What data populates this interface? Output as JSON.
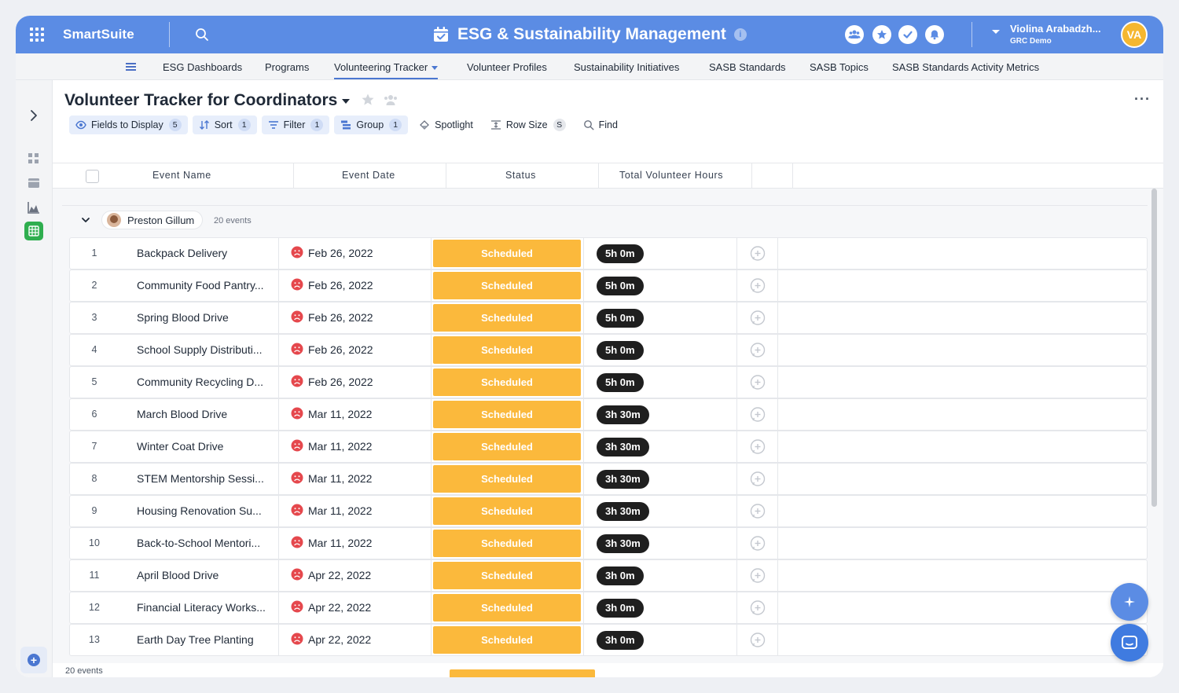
{
  "app": {
    "brand": "SmartSuite",
    "title": "ESG & Sustainability Management",
    "info_glyph": "i",
    "user_name": "Violina Arabadzh...",
    "user_org": "GRC Demo",
    "avatar_initials": "VA"
  },
  "nav": {
    "tabs": [
      {
        "label": "ESG Dashboards"
      },
      {
        "label": "Programs"
      },
      {
        "label": "Volunteering Tracker"
      },
      {
        "label": "Volunteer Profiles"
      },
      {
        "label": "Sustainability Initiatives"
      },
      {
        "label": "SASB Standards"
      },
      {
        "label": "SASB Topics"
      },
      {
        "label": "SASB Standards Activity Metrics"
      }
    ],
    "active_tab": "Volunteering Tracker"
  },
  "view": {
    "title": "Volunteer Tracker for Coordinators",
    "more": "···"
  },
  "toolbar": {
    "fields": {
      "label": "Fields to Display",
      "count": "5"
    },
    "sort": {
      "label": "Sort",
      "count": "1"
    },
    "filter": {
      "label": "Filter",
      "count": "1"
    },
    "group": {
      "label": "Group",
      "count": "1"
    },
    "spotlight": {
      "label": "Spotlight"
    },
    "rowsize": {
      "label": "Row Size",
      "count": "S"
    },
    "find": {
      "label": "Find"
    }
  },
  "grid": {
    "columns": [
      "Event Name",
      "Event Date",
      "Status",
      "Total Volunteer Hours"
    ],
    "group": {
      "name": "Preston Gillum",
      "count": "20 events"
    },
    "rows": [
      {
        "num": "1",
        "name": "Backpack Delivery",
        "date": "Feb 26, 2022",
        "status": "Scheduled",
        "hours": "5h 0m"
      },
      {
        "num": "2",
        "name": "Community Food Pantry...",
        "date": "Feb 26, 2022",
        "status": "Scheduled",
        "hours": "5h 0m"
      },
      {
        "num": "3",
        "name": "Spring Blood Drive",
        "date": "Feb 26, 2022",
        "status": "Scheduled",
        "hours": "5h 0m"
      },
      {
        "num": "4",
        "name": "School Supply Distributi...",
        "date": "Feb 26, 2022",
        "status": "Scheduled",
        "hours": "5h 0m"
      },
      {
        "num": "5",
        "name": "Community Recycling D...",
        "date": "Feb 26, 2022",
        "status": "Scheduled",
        "hours": "5h 0m"
      },
      {
        "num": "6",
        "name": "March Blood Drive",
        "date": "Mar 11, 2022",
        "status": "Scheduled",
        "hours": "3h 30m"
      },
      {
        "num": "7",
        "name": "Winter Coat Drive",
        "date": "Mar 11, 2022",
        "status": "Scheduled",
        "hours": "3h 30m"
      },
      {
        "num": "8",
        "name": "STEM Mentorship Sessi...",
        "date": "Mar 11, 2022",
        "status": "Scheduled",
        "hours": "3h 30m"
      },
      {
        "num": "9",
        "name": "Housing Renovation Su...",
        "date": "Mar 11, 2022",
        "status": "Scheduled",
        "hours": "3h 30m"
      },
      {
        "num": "10",
        "name": "Back-to-School Mentori...",
        "date": "Mar 11, 2022",
        "status": "Scheduled",
        "hours": "3h 30m"
      },
      {
        "num": "11",
        "name": "April Blood Drive",
        "date": "Apr 22, 2022",
        "status": "Scheduled",
        "hours": "3h 0m"
      },
      {
        "num": "12",
        "name": "Financial Literacy Works...",
        "date": "Apr 22, 2022",
        "status": "Scheduled",
        "hours": "3h 0m"
      },
      {
        "num": "13",
        "name": "Earth Day Tree Planting",
        "date": "Apr 22, 2022",
        "status": "Scheduled",
        "hours": "3h 0m"
      }
    ],
    "footer_count": "20 events"
  },
  "colors": {
    "topbar": "#5b8ce4",
    "status_scheduled": "#fbb93c",
    "hours_pill": "#1f1f1f",
    "overdue_icon": "#e5484d",
    "active_view": "#2fae4f"
  },
  "icons": {
    "top_right": [
      "team-icon",
      "star-icon",
      "check-icon",
      "bell-icon"
    ],
    "rail": [
      "chevron-right-icon",
      "dashboard-icon",
      "card-icon",
      "chart-icon",
      "grid-icon",
      "add-icon"
    ],
    "date_status": "sad-face-icon",
    "row_action": "add-comment-icon"
  }
}
